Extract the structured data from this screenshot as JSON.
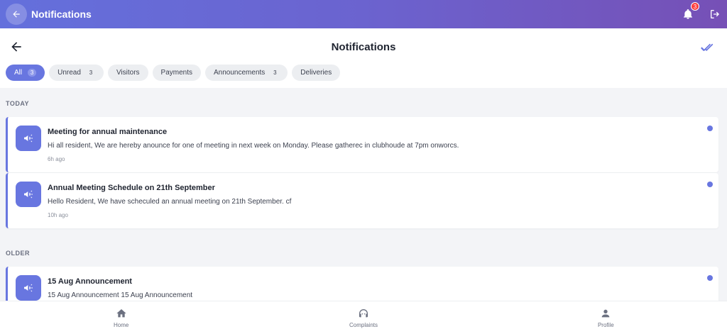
{
  "topbar": {
    "title": "Notifications",
    "notification_count": "3"
  },
  "header": {
    "title": "Notifications"
  },
  "filters": [
    {
      "label": "All",
      "count": "3",
      "active": true
    },
    {
      "label": "Unread",
      "count": "3",
      "active": false
    },
    {
      "label": "Visitors",
      "count": "",
      "active": false
    },
    {
      "label": "Payments",
      "count": "",
      "active": false
    },
    {
      "label": "Announcements",
      "count": "3",
      "active": false
    },
    {
      "label": "Deliveries",
      "count": "",
      "active": false
    }
  ],
  "sections": {
    "today": "TODAY",
    "older": "OLDER"
  },
  "notifications": [
    {
      "title": "Meeting for annual maintenance",
      "message": "Hi all resident, We are hereby anounce for one of meeting in next week on Monday. Please gatherec in clubhoude at 7pm onworcs.",
      "time": "6h ago"
    },
    {
      "title": "Annual Meeting Schedule on 21th September",
      "message": "Hello Resident, We have scheculed an annual meeting on 21th September. cf",
      "time": "10h ago"
    },
    {
      "title": "15 Aug Announcement",
      "message": "15 Aug Announcement 15 Aug Announcement",
      "time": ""
    }
  ],
  "bottom_nav": [
    {
      "label": "Home",
      "icon": "home-icon"
    },
    {
      "label": "Complaints",
      "icon": "complaints-icon"
    },
    {
      "label": "Profile",
      "icon": "profile-icon"
    }
  ],
  "colors": {
    "accent": "#6876e0",
    "gradient_start": "#6470dc",
    "gradient_end": "#7650b6",
    "badge": "#ff3b3b"
  }
}
